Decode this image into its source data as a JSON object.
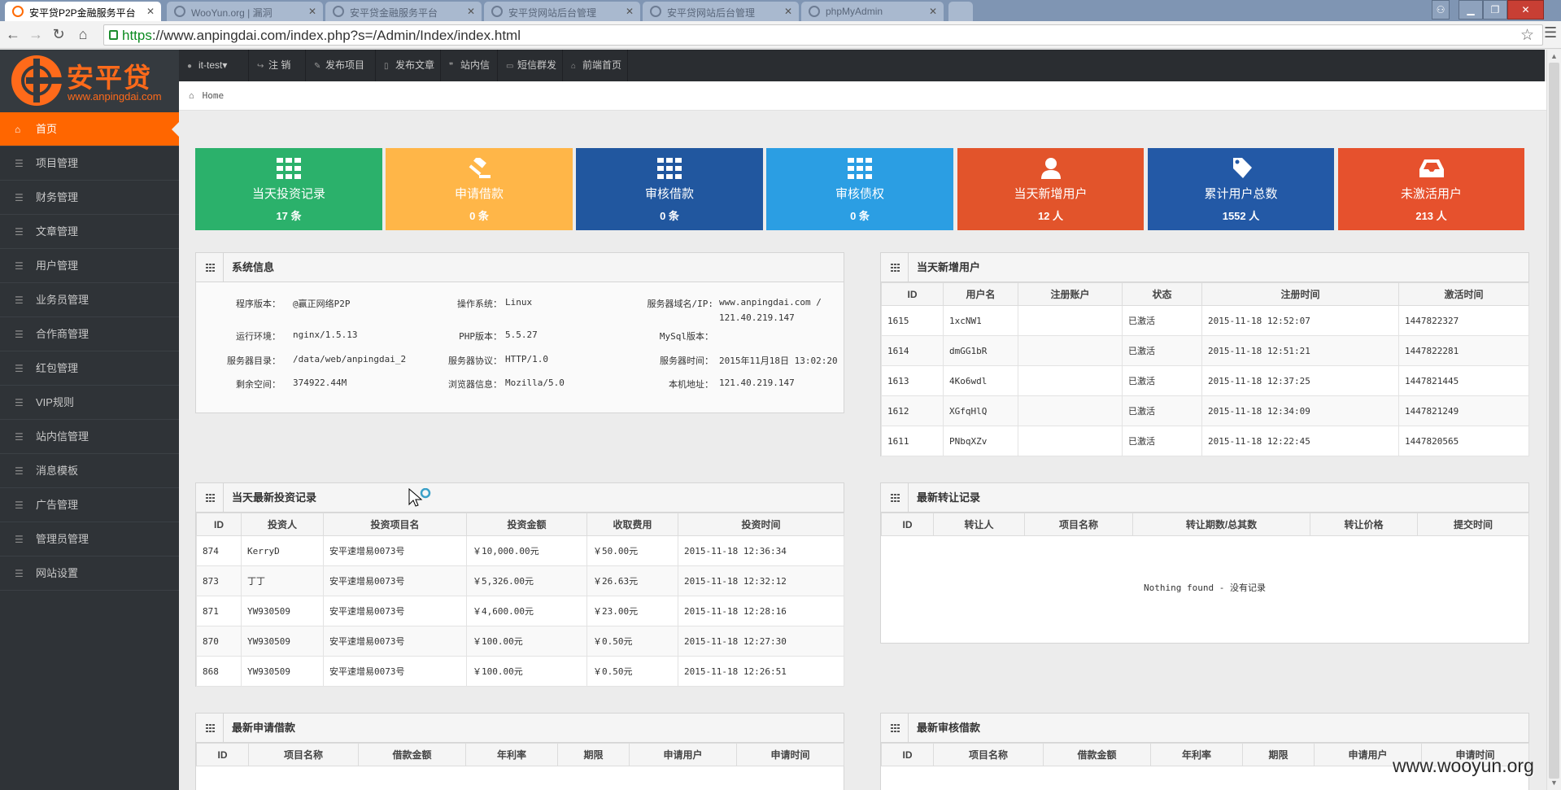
{
  "browser": {
    "tabs": [
      {
        "title": "安平贷P2P金融服务平台"
      },
      {
        "title": "WooYun.org | 漏洞"
      },
      {
        "title": "安平贷金融服务平台"
      },
      {
        "title": "安平贷网站后台管理"
      },
      {
        "title": "安平贷网站后台管理"
      },
      {
        "title": "phpMyAdmin"
      }
    ],
    "url_scheme": "https",
    "url_rest": "://www.anpingdai.com/index.php?s=/Admin/Index/index.html",
    "close_glyph": "✕"
  },
  "logo": {
    "text": "安平贷",
    "url": "www.anpingdai.com"
  },
  "topnav": [
    {
      "label": "it-test▾",
      "icon": "user-icon"
    },
    {
      "label": "注 销",
      "icon": "share-icon"
    },
    {
      "label": "发布项目",
      "icon": "edit-icon"
    },
    {
      "label": "发布文章",
      "icon": "file-icon"
    },
    {
      "label": "站内信",
      "icon": "comment-icon"
    },
    {
      "label": "短信群发",
      "icon": "phone-icon"
    },
    {
      "label": "前端首页",
      "icon": "home-icon"
    }
  ],
  "breadcrumb": {
    "home": "Home"
  },
  "sidebar": {
    "items": [
      {
        "label": "首页",
        "active": true
      },
      {
        "label": "项目管理"
      },
      {
        "label": "财务管理"
      },
      {
        "label": "文章管理"
      },
      {
        "label": "用户管理"
      },
      {
        "label": "业务员管理"
      },
      {
        "label": "合作商管理"
      },
      {
        "label": "红包管理"
      },
      {
        "label": "VIP规则"
      },
      {
        "label": "站内信管理"
      },
      {
        "label": "消息模板"
      },
      {
        "label": "广告管理"
      },
      {
        "label": "管理员管理"
      },
      {
        "label": "网站设置"
      }
    ]
  },
  "stats": [
    {
      "label": "当天投资记录",
      "value": "17 条",
      "color": "#2bb16b",
      "icon": "grid-icon"
    },
    {
      "label": "申请借款",
      "value": "0 条",
      "color": "#ffb648",
      "icon": "gavel-icon"
    },
    {
      "label": "审核借款",
      "value": "0 条",
      "color": "#21579f",
      "icon": "grid-icon"
    },
    {
      "label": "审核债权",
      "value": "0 条",
      "color": "#2b9ee3",
      "icon": "grid-icon"
    },
    {
      "label": "当天新增用户",
      "value": "12 人",
      "color": "#e2542b",
      "icon": "user-icon"
    },
    {
      "label": "累计用户总数",
      "value": "1552 人",
      "color": "#2359a6",
      "icon": "tag-icon"
    },
    {
      "label": "未激活用户",
      "value": "213 人",
      "color": "#e6512d",
      "icon": "inbox-icon"
    }
  ],
  "sysinfo": {
    "title": "系统信息",
    "rows": [
      [
        {
          "label": "程序版本：",
          "value": "@赢正网络P2P"
        },
        {
          "label": "操作系统：",
          "value": "Linux"
        },
        {
          "label": "服务器域名/IP:",
          "value": "www.anpingdai.com /"
        }
      ],
      [
        {
          "label": "",
          "value": ""
        },
        {
          "label": "",
          "value": ""
        },
        {
          "label": "",
          "value": "121.40.219.147"
        }
      ],
      [
        {
          "label": "运行环境：",
          "value": "nginx/1.5.13"
        },
        {
          "label": "PHP版本：",
          "value": "5.5.27"
        },
        {
          "label": "MySql版本：",
          "value": ""
        }
      ],
      [
        {
          "label": "服务器目录：",
          "value": "/data/web/anpingdai_2"
        },
        {
          "label": "服务器协议：",
          "value": "HTTP/1.0"
        },
        {
          "label": "服务器时间：",
          "value": "2015年11月18日 13:02:20"
        }
      ],
      [
        {
          "label": "剩余空间：",
          "value": "374922.44M"
        },
        {
          "label": "浏览器信息：",
          "value": "Mozilla/5.0"
        },
        {
          "label": "本机地址：",
          "value": "121.40.219.147"
        }
      ]
    ]
  },
  "new_users": {
    "title": "当天新增用户",
    "headers": [
      "ID",
      "用户名",
      "注册账户",
      "状态",
      "注册时间",
      "激活时间"
    ],
    "rows": [
      [
        "1615",
        "1xcNW1",
        "",
        "已激活",
        "2015-11-18 12:52:07",
        "1447822327"
      ],
      [
        "1614",
        "dmGG1bR",
        "",
        "已激活",
        "2015-11-18 12:51:21",
        "1447822281"
      ],
      [
        "1613",
        "4Ko6wdl",
        "",
        "已激活",
        "2015-11-18 12:37:25",
        "1447821445"
      ],
      [
        "1612",
        "XGfqHlQ",
        "",
        "已激活",
        "2015-11-18 12:34:09",
        "1447821249"
      ],
      [
        "1611",
        "PNbqXZv",
        "",
        "已激活",
        "2015-11-18 12:22:45",
        "1447820565"
      ]
    ]
  },
  "investments": {
    "title": "当天最新投资记录",
    "headers": [
      "ID",
      "投资人",
      "投资项目名",
      "投资金额",
      "收取费用",
      "投资时间"
    ],
    "rows": [
      [
        "874",
        "KerryD",
        "安平速增易0073号",
        "￥10,000.00元",
        "￥50.00元",
        "2015-11-18 12:36:34"
      ],
      [
        "873",
        "丁丁",
        "安平速增易0073号",
        "￥5,326.00元",
        "￥26.63元",
        "2015-11-18 12:32:12"
      ],
      [
        "871",
        "YW930509",
        "安平速增易0073号",
        "￥4,600.00元",
        "￥23.00元",
        "2015-11-18 12:28:16"
      ],
      [
        "870",
        "YW930509",
        "安平速增易0073号",
        "￥100.00元",
        "￥0.50元",
        "2015-11-18 12:27:30"
      ],
      [
        "868",
        "YW930509",
        "安平速增易0073号",
        "￥100.00元",
        "￥0.50元",
        "2015-11-18 12:26:51"
      ]
    ]
  },
  "transfers": {
    "title": "最新转让记录",
    "headers": [
      "ID",
      "转让人",
      "项目名称",
      "转让期数/总其数",
      "转让价格",
      "提交时间"
    ],
    "empty": "Nothing found - 没有记录"
  },
  "loan_apps": {
    "title": "最新申请借款",
    "headers": [
      "ID",
      "项目名称",
      "借款金额",
      "年利率",
      "期限",
      "申请用户",
      "申请时间"
    ]
  },
  "loan_reviews": {
    "title": "最新审核借款",
    "headers": [
      "ID",
      "项目名称",
      "借款金额",
      "年利率",
      "期限",
      "申请用户",
      "申请时间"
    ]
  },
  "watermark": "www.wooyun.org"
}
